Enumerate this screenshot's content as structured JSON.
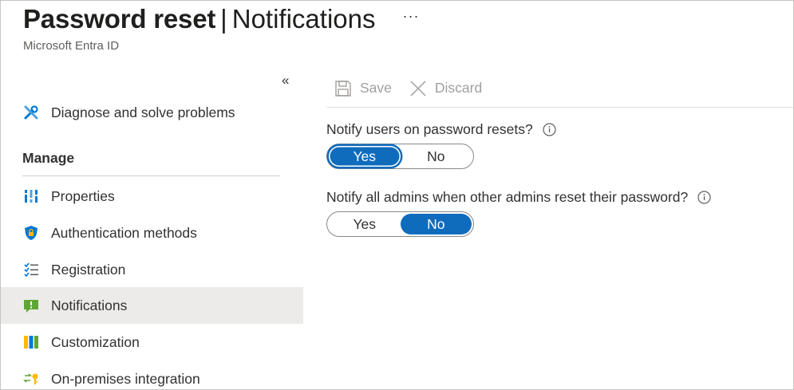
{
  "header": {
    "title_strong": "Password reset",
    "separator": "|",
    "title_page": "Notifications",
    "more_label": "···",
    "subtitle": "Microsoft Entra ID"
  },
  "sidebar": {
    "collapse_label": "«",
    "diagnose_label": "Diagnose and solve problems",
    "section_title": "Manage",
    "items": [
      {
        "label": "Properties",
        "icon": "properties-icon"
      },
      {
        "label": "Authentication methods",
        "icon": "shield-icon"
      },
      {
        "label": "Registration",
        "icon": "checklist-icon"
      },
      {
        "label": "Notifications",
        "icon": "notification-icon",
        "selected": true
      },
      {
        "label": "Customization",
        "icon": "customization-icon"
      },
      {
        "label": "On-premises integration",
        "icon": "on-premises-icon"
      }
    ]
  },
  "toolbar": {
    "save_label": "Save",
    "discard_label": "Discard"
  },
  "settings": {
    "notify_users": {
      "question": "Notify users on password resets?",
      "yes_label": "Yes",
      "no_label": "No",
      "selected": "Yes"
    },
    "notify_admins": {
      "question": "Notify all admins when other admins reset their password?",
      "yes_label": "Yes",
      "no_label": "No",
      "selected": "No"
    }
  },
  "colors": {
    "accent": "#0f6cbd",
    "selected_bg": "#edebe9",
    "disabled_text": "#a19f9d"
  }
}
